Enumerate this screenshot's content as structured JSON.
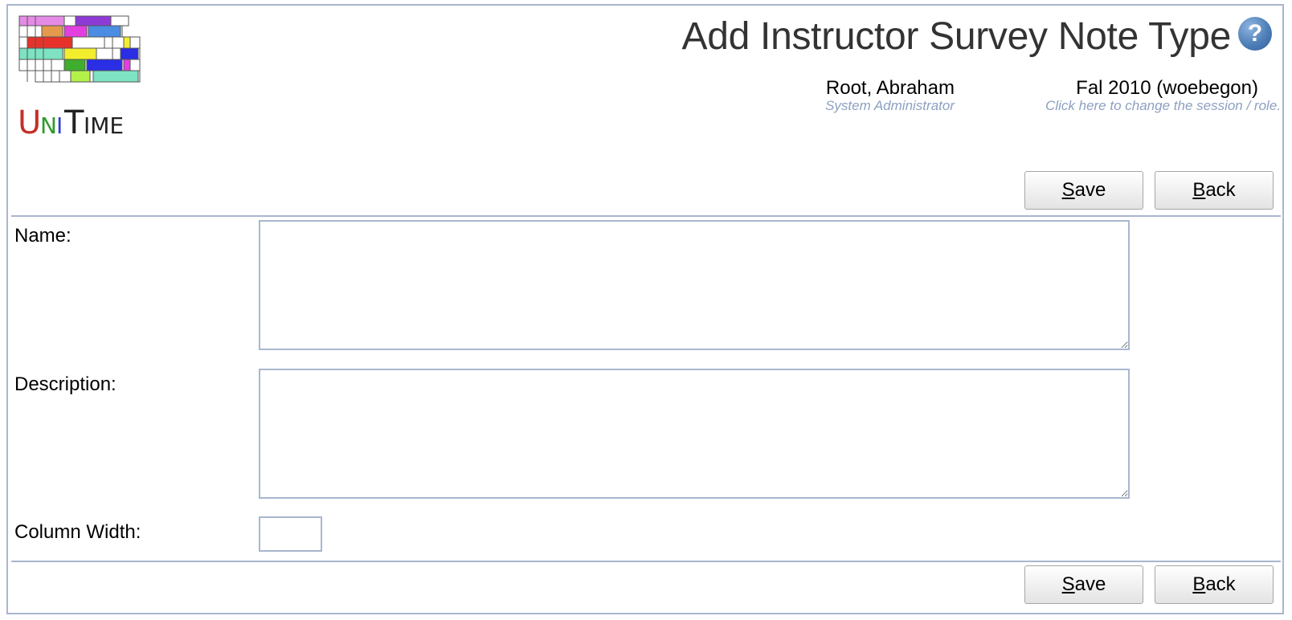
{
  "app": {
    "logo_text": "UniTime"
  },
  "header": {
    "title": "Add Instructor Survey Note Type",
    "help_icon": "question-circle-icon",
    "user": {
      "name": "Root, Abraham",
      "role": "System Administrator"
    },
    "session": {
      "name": "Fal 2010 (woebegon)",
      "hint": "Click here to change the session / role."
    }
  },
  "buttons": {
    "save_label": "Save",
    "save_accesskey": "S",
    "save_rest": "ave",
    "back_label": "Back",
    "back_accesskey": "B",
    "back_rest": "ack"
  },
  "form": {
    "name": {
      "label": "Name:",
      "value": ""
    },
    "description": {
      "label": "Description:",
      "value": ""
    },
    "column_width": {
      "label": "Column Width:",
      "value": ""
    }
  },
  "colors": {
    "border": "#a9b6cf",
    "title": "#333333",
    "hint": "#8da0c2",
    "help": "#4e7fb8"
  }
}
